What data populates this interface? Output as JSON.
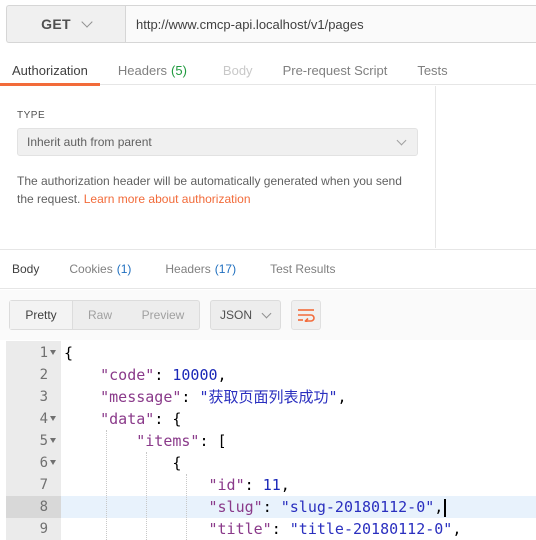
{
  "request": {
    "method": "GET",
    "url": "http://www.cmcp-api.localhost/v1/pages"
  },
  "request_tabs": [
    {
      "label": "Authorization",
      "count": "",
      "state": "active"
    },
    {
      "label": "Headers",
      "count": "(5)",
      "state": "normal"
    },
    {
      "label": "Body",
      "count": "",
      "state": "disabled"
    },
    {
      "label": "Pre-request Script",
      "count": "",
      "state": "normal"
    },
    {
      "label": "Tests",
      "count": "",
      "state": "normal"
    }
  ],
  "auth": {
    "type_label": "TYPE",
    "type_value": "Inherit auth from parent",
    "description": "The authorization header will be automatically generated when you send the request.",
    "link_text": "Learn more about authorization"
  },
  "response_tabs": [
    {
      "label": "Body",
      "count": "",
      "state": "active"
    },
    {
      "label": "Cookies",
      "count": "(1)",
      "state": "normal"
    },
    {
      "label": "Headers",
      "count": "(17)",
      "state": "normal"
    },
    {
      "label": "Test Results",
      "count": "",
      "state": "normal"
    }
  ],
  "format": {
    "modes": [
      "Pretty",
      "Raw",
      "Preview"
    ],
    "active_mode": "Pretty",
    "language": "JSON",
    "wrap_icon": "wrap-lines-icon"
  },
  "editor": {
    "highlighted_line": 8,
    "lines": [
      {
        "num": "1",
        "fold": true,
        "text": "{"
      },
      {
        "num": "2",
        "fold": false,
        "text": "    \"code\": 10000,"
      },
      {
        "num": "3",
        "fold": false,
        "text": "    \"message\": \"获取页面列表成功\","
      },
      {
        "num": "4",
        "fold": true,
        "text": "    \"data\": {"
      },
      {
        "num": "5",
        "fold": true,
        "text": "        \"items\": ["
      },
      {
        "num": "6",
        "fold": true,
        "text": "            {"
      },
      {
        "num": "7",
        "fold": false,
        "text": "                \"id\": 11,"
      },
      {
        "num": "8",
        "fold": false,
        "text": "                \"slug\": \"slug-20180112-0\","
      },
      {
        "num": "9",
        "fold": false,
        "text": "                \"title\": \"title-20180112-0\","
      }
    ]
  },
  "colors": {
    "accent": "#f26b3a",
    "count_green": "#1f9a3e",
    "count_blue": "#1f6fbf",
    "json_key": "#8a3a8a",
    "json_string": "#2a2fbf",
    "json_number": "#1a28b8"
  }
}
